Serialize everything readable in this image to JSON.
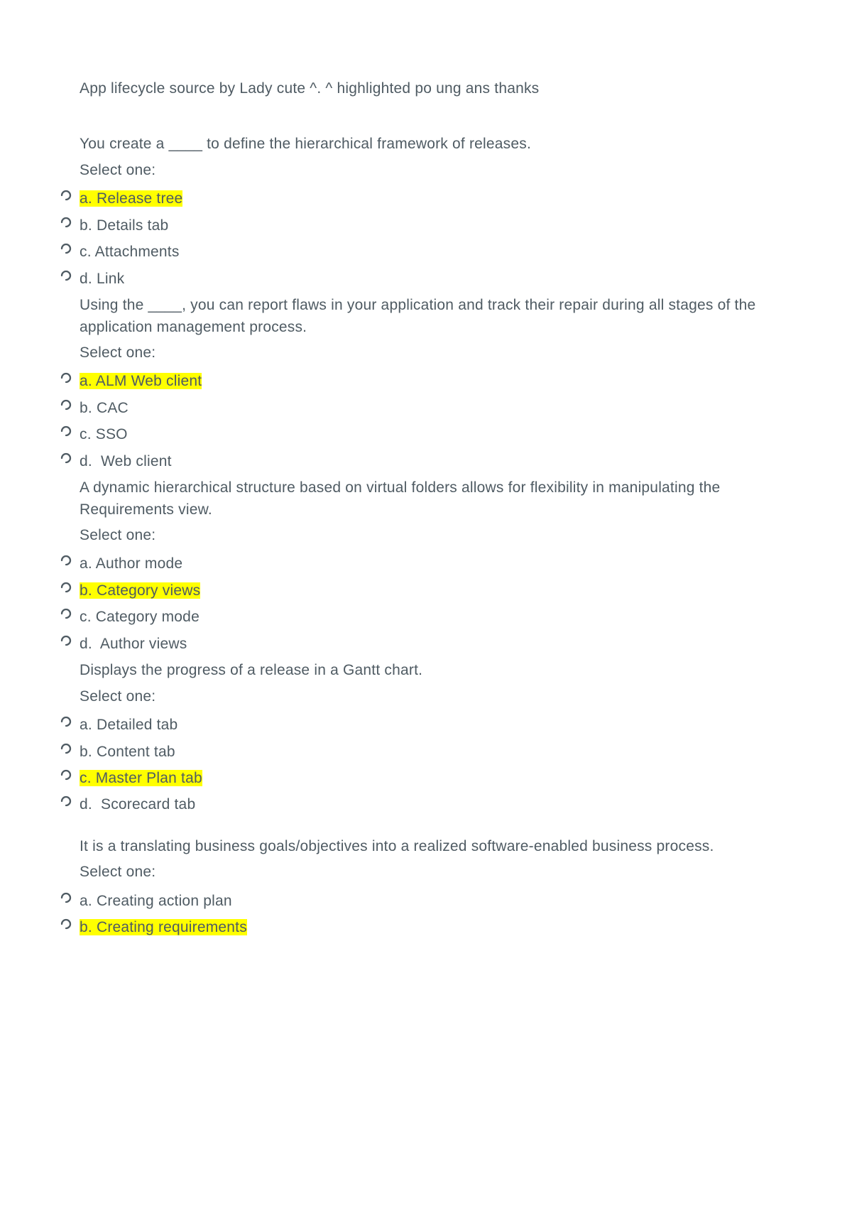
{
  "title": "App lifecycle source by Lady cute  ^. ^ highlighted po ung ans thanks",
  "select_one": "Select one:",
  "q1": {
    "text": "You create a ____ to define the hierarchical framework of releases.",
    "a": "a. Release tree",
    "b": "b. Details tab",
    "c": "c. Attachments",
    "d": "d. Link"
  },
  "q2": {
    "text": "Using the ____, you can report flaws in your application and track their repair during all stages of the application management process.",
    "a": "a. ALM Web client",
    "b": "b. CAC",
    "c": "c. SSO",
    "d": "d.  Web client"
  },
  "q3": {
    "text": "A dynamic hierarchical structure based on virtual folders allows for flexibility in manipulating the Requirements view.",
    "a": "a. Author mode",
    "b": "b. Category views",
    "c": "c. Category mode",
    "d": "d.  Author views"
  },
  "q4": {
    "text": "Displays the progress of a release in a Gantt chart.",
    "a": "a. Detailed tab",
    "b": "b. Content tab",
    "c": "c. Master Plan tab",
    "d": "d.  Scorecard tab"
  },
  "q5": {
    "text": "It is a translating business goals/objectives into a realized software-enabled business process.",
    "a": "a. Creating action plan",
    "b": "b. Creating requirements"
  }
}
